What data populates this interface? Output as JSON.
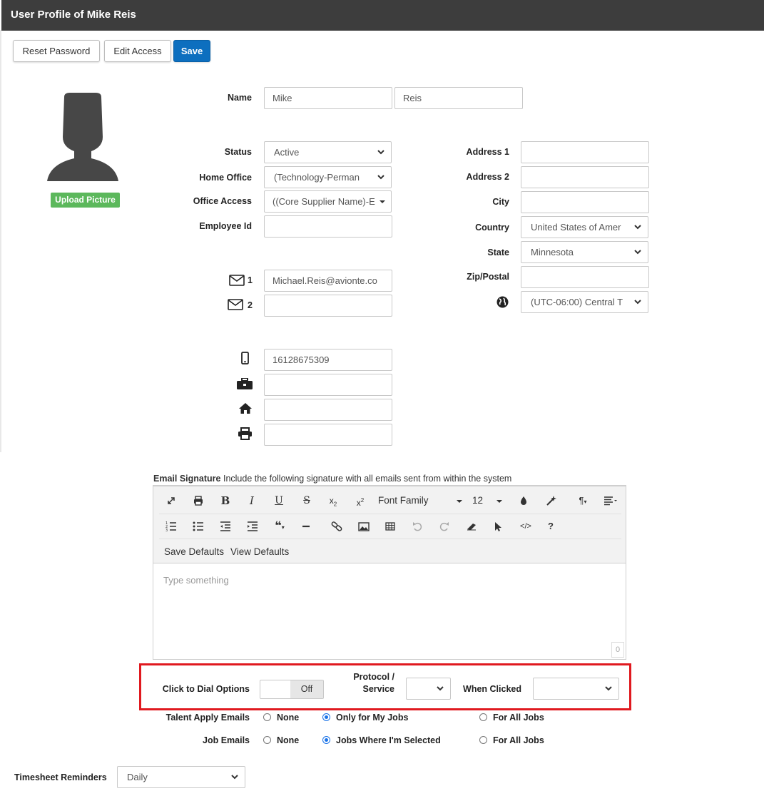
{
  "header": {
    "title": "User Profile of Mike Reis"
  },
  "toolbar": {
    "reset_password": "Reset Password",
    "edit_access": "Edit Access",
    "save": "Save"
  },
  "avatar": {
    "upload_label": "Upload Picture"
  },
  "form": {
    "name_label": "Name",
    "first_name": "Mike",
    "last_name": "Reis",
    "status_label": "Status",
    "status_value": "Active",
    "home_office_label": "Home Office",
    "home_office_value": "(Technology-Perman",
    "office_access_label": "Office Access",
    "office_access_value": "((Core Supplier Name)-E",
    "employee_id_label": "Employee Id",
    "employee_id_value": "",
    "email1_num": "1",
    "email1_value": "Michael.Reis@avionte.co",
    "email2_num": "2",
    "email2_value": "",
    "mobile_value": "16128675309",
    "work_phone_value": "",
    "home_phone_value": "",
    "fax_value": "",
    "address1_label": "Address 1",
    "address1_value": "",
    "address2_label": "Address 2",
    "address2_value": "",
    "city_label": "City",
    "city_value": "",
    "country_label": "Country",
    "country_value": "United States of Amer",
    "state_label": "State",
    "state_value": "Minnesota",
    "zip_label": "Zip/Postal",
    "zip_value": "",
    "timezone_value": "(UTC-06:00) Central T"
  },
  "signature": {
    "label": "Email Signature",
    "description": "Include the following signature with all emails sent from within the system",
    "font_family": "Font Family",
    "font_size": "12",
    "save_defaults": "Save Defaults",
    "view_defaults": "View Defaults",
    "placeholder": "Type something",
    "char_count": "0"
  },
  "dial": {
    "label": "Click to Dial Options",
    "toggle_state": "Off",
    "protocol_label_line1": "Protocol /",
    "protocol_label_line2": "Service",
    "protocol_value": "",
    "when_clicked_label": "When Clicked",
    "when_clicked_value": ""
  },
  "talent_emails": {
    "label": "Talent Apply Emails",
    "options": [
      "None",
      "Only for My Jobs",
      "For All Jobs"
    ],
    "selected": "Only for My Jobs"
  },
  "job_emails": {
    "label": "Job Emails",
    "options": [
      "None",
      "Jobs Where I'm Selected",
      "For All Jobs"
    ],
    "selected": "Jobs Where I'm Selected"
  },
  "timesheet": {
    "label": "Timesheet Reminders",
    "value": "Daily"
  },
  "colors": {
    "header_bg": "#3d3d3d",
    "primary": "#0d6fbf",
    "upload_green": "#5cb85c",
    "highlight_red": "#e0191f"
  }
}
